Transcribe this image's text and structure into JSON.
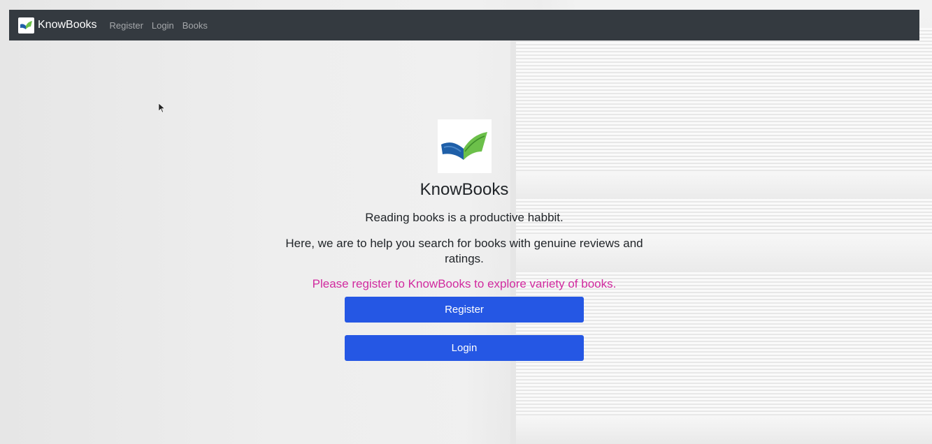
{
  "navbar": {
    "brand": "KnowBooks",
    "links": [
      "Register",
      "Login",
      "Books"
    ]
  },
  "hero": {
    "title": "KnowBooks",
    "tagline": "Reading books is a productive habbit.",
    "description": "Here, we are to help you search for books with genuine reviews and ratings.",
    "invite": "Please register to KnowBooks to explore variety of books."
  },
  "buttons": {
    "register": "Register",
    "login": "Login"
  },
  "colors": {
    "navbar": "#343a40",
    "button": "#2557e4",
    "invite": "#d12a9f",
    "logo_blue": "#1f5fa8",
    "logo_green": "#6cc04a"
  },
  "icons": {
    "brand": "open-book-icon",
    "cursor": "mouse-pointer-icon"
  }
}
